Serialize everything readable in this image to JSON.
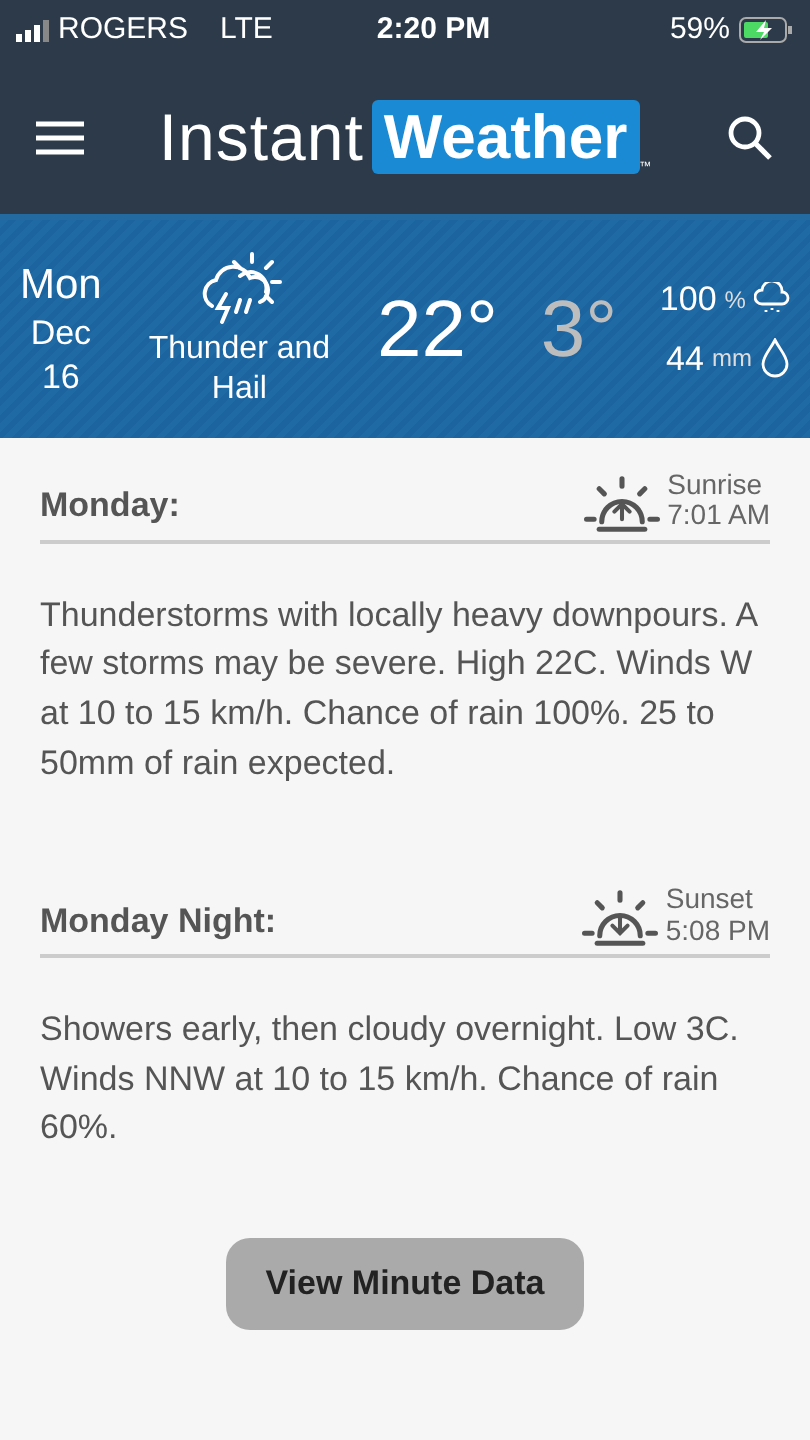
{
  "status_bar": {
    "carrier": "ROGERS",
    "network": "LTE",
    "time": "2:20 PM",
    "battery": "59%"
  },
  "app_bar": {
    "logo_left": "Instant",
    "logo_right": "Weather",
    "trademark": "™"
  },
  "summary": {
    "day": "Mon",
    "month": "Dec",
    "date": "16",
    "condition": "Thunder and Hail",
    "high": "22°",
    "low": "3°",
    "precip_chance": "100",
    "precip_chance_unit": "%",
    "precip_amount": "44",
    "precip_amount_unit": "mm"
  },
  "periods": [
    {
      "title": "Monday:",
      "kind": "rise",
      "sun_label": "Sunrise",
      "sun_time": "7:01 AM",
      "text": "Thunderstorms with locally heavy downpours. A few storms may be severe. High 22C. Winds W at 10 to 15 km/h. Chance of rain 100%. 25 to 50mm of rain expected."
    },
    {
      "title": "Monday Night:",
      "kind": "set",
      "sun_label": "Sunset",
      "sun_time": "5:08 PM",
      "text": "Showers early, then cloudy overnight. Low 3C. Winds NNW at 10 to 15 km/h. Chance of rain 60%."
    }
  ],
  "button": "View Minute Data"
}
